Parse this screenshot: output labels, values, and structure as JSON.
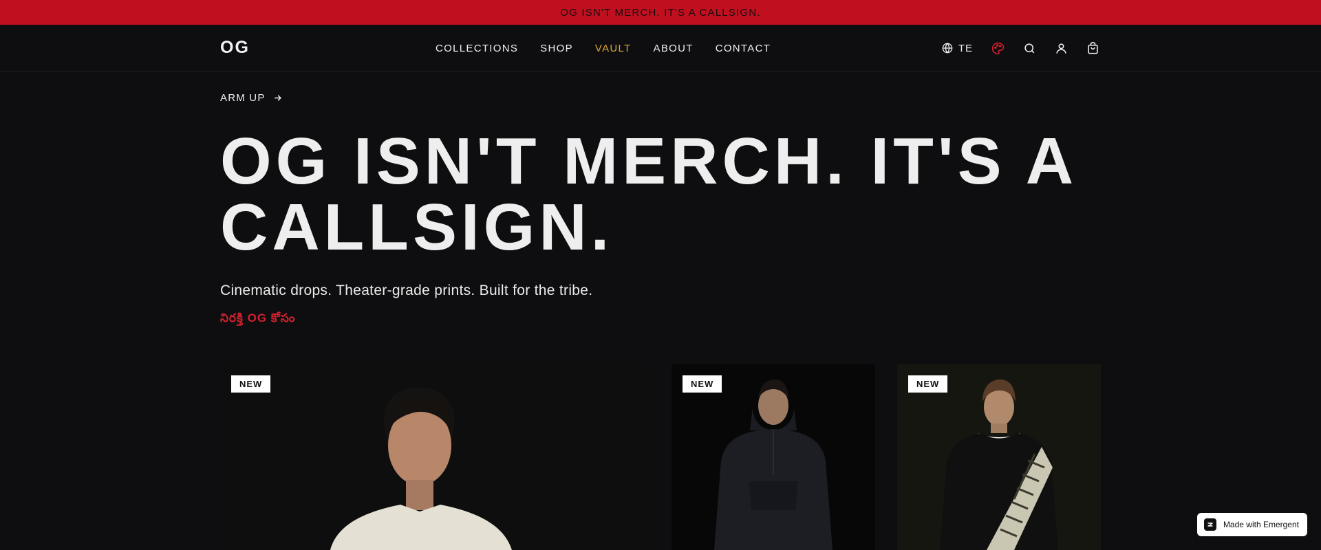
{
  "announcement": {
    "text": "OG ISN'T MERCH. IT'S A CALLSIGN."
  },
  "header": {
    "brand": "OG",
    "nav": [
      "COLLECTIONS",
      "SHOP",
      "VAULT",
      "ABOUT",
      "CONTACT"
    ],
    "active_nav": "VAULT",
    "language": "TE",
    "icons": [
      "globe-icon",
      "palette-icon",
      "search-icon",
      "user-icon",
      "bag-icon"
    ]
  },
  "hero": {
    "cta_label": "ARM UP",
    "headline_line1": "OG ISN'T MERCH. IT'S A",
    "headline_line2": "CALLSIGN.",
    "tagline": "Cinematic drops. Theater-grade prints. Built for the tribe.",
    "telugu_tagline": "నిరక్తి OG కోసం"
  },
  "products": [
    {
      "badge": "NEW"
    },
    {
      "badge": "NEW"
    },
    {
      "badge": "NEW"
    }
  ],
  "footer_badge": {
    "text": "Made with Emergent"
  },
  "colors": {
    "accent_red": "#c01020",
    "active_nav_gold": "#d9a63a",
    "background": "#0e0e10"
  }
}
